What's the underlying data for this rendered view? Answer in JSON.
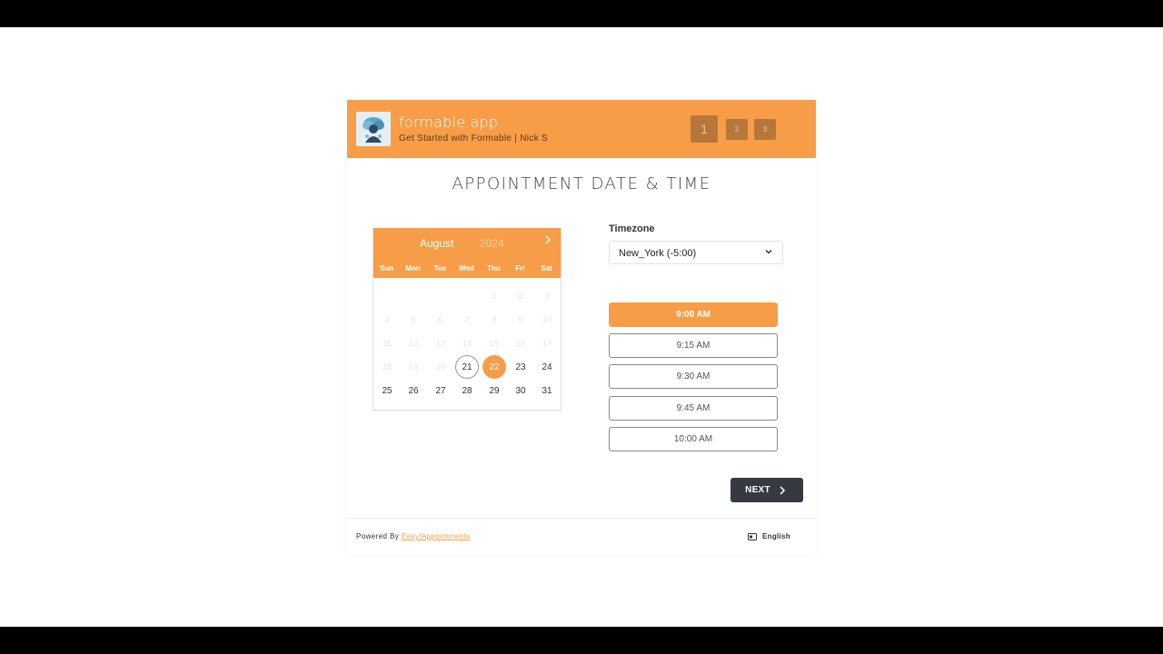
{
  "header": {
    "company_name": "formable.app",
    "subtitle": "Get Started with Formable | Nick S",
    "steps": [
      "1",
      "2",
      "3"
    ]
  },
  "page_title": "APPOINTMENT DATE & TIME",
  "calendar": {
    "month": "August",
    "year": "2024",
    "weekdays": [
      "Sun",
      "Mon",
      "Tue",
      "Wed",
      "Thu",
      "Fri",
      "Sat"
    ],
    "days": [
      {
        "label": "1",
        "state": "disabled"
      },
      {
        "label": "2",
        "state": "disabled"
      },
      {
        "label": "3",
        "state": "disabled"
      },
      {
        "label": "4",
        "state": "disabled"
      },
      {
        "label": "5",
        "state": "disabled"
      },
      {
        "label": "6",
        "state": "disabled"
      },
      {
        "label": "7",
        "state": "disabled"
      },
      {
        "label": "8",
        "state": "disabled"
      },
      {
        "label": "9",
        "state": "disabled"
      },
      {
        "label": "10",
        "state": "disabled"
      },
      {
        "label": "11",
        "state": "disabled"
      },
      {
        "label": "12",
        "state": "disabled"
      },
      {
        "label": "13",
        "state": "disabled"
      },
      {
        "label": "14",
        "state": "disabled"
      },
      {
        "label": "15",
        "state": "disabled"
      },
      {
        "label": "16",
        "state": "disabled"
      },
      {
        "label": "17",
        "state": "disabled"
      },
      {
        "label": "18",
        "state": "disabled"
      },
      {
        "label": "19",
        "state": "disabled"
      },
      {
        "label": "20",
        "state": "disabled"
      },
      {
        "label": "21",
        "state": "today"
      },
      {
        "label": "22",
        "state": "selected"
      },
      {
        "label": "23",
        "state": "enabled"
      },
      {
        "label": "24",
        "state": "enabled"
      },
      {
        "label": "25",
        "state": "enabled"
      },
      {
        "label": "26",
        "state": "enabled"
      },
      {
        "label": "27",
        "state": "enabled"
      },
      {
        "label": "28",
        "state": "enabled"
      },
      {
        "label": "29",
        "state": "enabled"
      },
      {
        "label": "30",
        "state": "enabled"
      },
      {
        "label": "31",
        "state": "enabled"
      }
    ]
  },
  "timezone": {
    "label": "Timezone",
    "value": "New_York (-5:00)"
  },
  "time_slots": [
    {
      "label": "9:00 AM",
      "selected": true
    },
    {
      "label": "9:15 AM",
      "selected": false
    },
    {
      "label": "9:30 AM",
      "selected": false
    },
    {
      "label": "9:45 AM",
      "selected": false
    },
    {
      "label": "10:00 AM",
      "selected": false
    }
  ],
  "next_button": "NEXT",
  "footer": {
    "powered_by": "Powered By",
    "link": "Easy!Appointments",
    "language": "English"
  },
  "colors": {
    "accent": "#f89d47",
    "step_bg": "#b6773a",
    "dark_button": "#343a40"
  },
  "icons": {
    "next_month": "chevron-right-icon",
    "dropdown": "chevron-down-icon",
    "next_button": "chevron-right-icon",
    "language": "language-icon"
  }
}
